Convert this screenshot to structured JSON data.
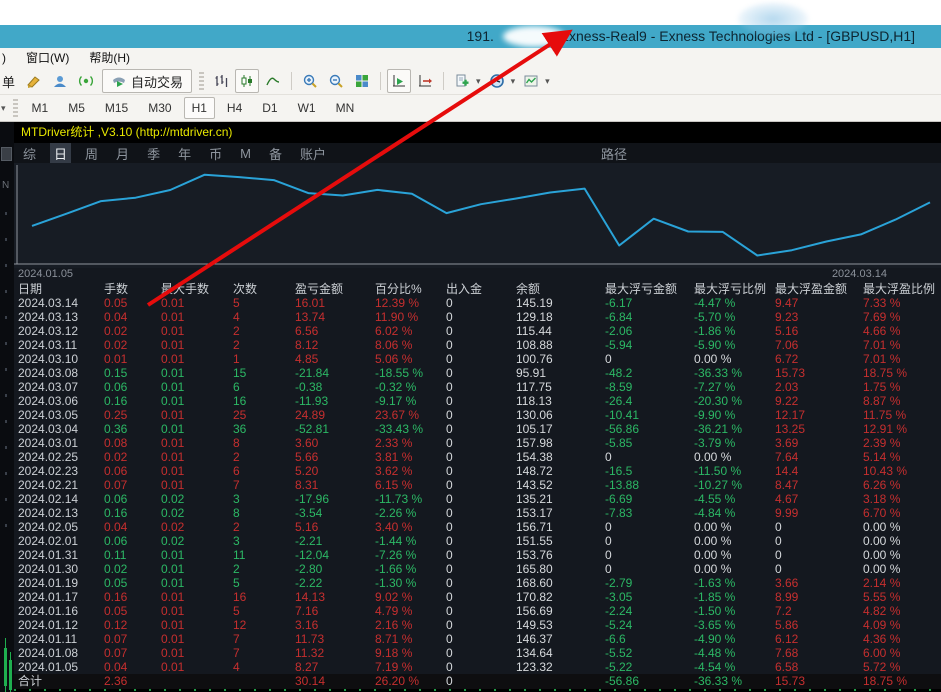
{
  "window": {
    "title_prefix": "191.",
    "title_rest": ". Exness-Real9 - Exness Technologies Ltd - [GBPUSD,H1]"
  },
  "menu": {
    "partial": ")",
    "items": [
      "窗口(W)",
      "帮助(H)"
    ]
  },
  "toolbar": {
    "partial_button": "单",
    "autotrade_label": "自动交易",
    "icons": [
      "crayon-icon",
      "community-icon",
      "signal-icon",
      "bar-chart-icon",
      "candlestick-icon",
      "line-chart-icon",
      "zoom-in-icon",
      "zoom-out-icon",
      "tile-windows-icon",
      "auto-scroll-icon",
      "chart-shift-icon",
      "new-template-icon",
      "period-icon",
      "indicators-icon"
    ],
    "timeframes": [
      "M1",
      "M5",
      "M15",
      "M30",
      "H1",
      "H4",
      "D1",
      "W1",
      "MN"
    ],
    "active_timeframe": "H1",
    "dropdown_caret": "▾"
  },
  "indicator": {
    "title": "MTDriver统计 ,V3.10 (http://mtdriver.cn)",
    "tabs": [
      "综",
      "日",
      "周",
      "月",
      "季",
      "年",
      "币",
      "M",
      "备",
      "账户"
    ],
    "active_tab": "日",
    "path_tab": "路径"
  },
  "chart_data": {
    "type": "line",
    "title": "",
    "x_dates": [
      "2024.01.05",
      "2024.01.08",
      "2024.01.11",
      "2024.01.12",
      "2024.01.16",
      "2024.01.17",
      "2024.01.19",
      "2024.01.30",
      "2024.01.31",
      "2024.02.01",
      "2024.02.05",
      "2024.02.13",
      "2024.02.14",
      "2024.02.21",
      "2024.02.23",
      "2024.02.25",
      "2024.03.01",
      "2024.03.04",
      "2024.03.05",
      "2024.03.06",
      "2024.03.07",
      "2024.03.08",
      "2024.03.10",
      "2024.03.11",
      "2024.03.12",
      "2024.03.13",
      "2024.03.14"
    ],
    "series": [
      {
        "name": "余额",
        "values": [
          123.32,
          134.64,
          146.37,
          149.53,
          156.69,
          170.82,
          168.6,
          165.8,
          153.76,
          151.55,
          156.71,
          153.17,
          135.21,
          143.52,
          148.72,
          154.38,
          157.98,
          105.17,
          130.06,
          118.13,
          117.75,
          95.91,
          100.76,
          108.88,
          115.44,
          129.18,
          145.19
        ]
      }
    ],
    "ylim": [
      88,
      178
    ],
    "xlabel_left": "2024.01.05",
    "xlabel_right": "2024.03.14",
    "line_color": "#2aa3d8",
    "grid": false,
    "legend": false
  },
  "table": {
    "headers": [
      "日期",
      "手数",
      "最大手数",
      "次数",
      "盈亏金额",
      "百分比%",
      "出入金",
      "余额",
      "最大浮亏金额",
      "最大浮亏比例",
      "最大浮盈金额",
      "最大浮盈比例"
    ],
    "rows": [
      {
        "date": "2024.03.14",
        "values": [
          "0.05",
          "0.01",
          "5",
          "16.01",
          "12.39 %",
          "0",
          "145.19",
          "-6.17",
          "-4.47 %",
          "9.47",
          "7.33 %"
        ],
        "colors": "rrrrrwwggrr"
      },
      {
        "date": "2024.03.13",
        "values": [
          "0.04",
          "0.01",
          "4",
          "13.74",
          "11.90 %",
          "0",
          "129.18",
          "-6.84",
          "-5.70 %",
          "9.23",
          "7.69 %"
        ],
        "colors": "rrrrrwwggrr"
      },
      {
        "date": "2024.03.12",
        "values": [
          "0.02",
          "0.01",
          "2",
          "6.56",
          "6.02 %",
          "0",
          "115.44",
          "-2.06",
          "-1.86 %",
          "5.16",
          "4.66 %"
        ],
        "colors": "rrrrrwwggrr"
      },
      {
        "date": "2024.03.11",
        "values": [
          "0.02",
          "0.01",
          "2",
          "8.12",
          "8.06 %",
          "0",
          "108.88",
          "-5.94",
          "-5.90 %",
          "7.06",
          "7.01 %"
        ],
        "colors": "rrrrrwwggrr"
      },
      {
        "date": "2024.03.10",
        "values": [
          "0.01",
          "0.01",
          "1",
          "4.85",
          "5.06 %",
          "0",
          "100.76",
          "0",
          "0.00 %",
          "6.72",
          "7.01 %"
        ],
        "colors": "rrrrrwwwwrr"
      },
      {
        "date": "2024.03.08",
        "values": [
          "0.15",
          "0.01",
          "15",
          "-21.84",
          "-18.55 %",
          "0",
          "95.91",
          "-48.2",
          "-36.33 %",
          "15.73",
          "18.75 %"
        ],
        "colors": "gggggwwggrr"
      },
      {
        "date": "2024.03.07",
        "values": [
          "0.06",
          "0.01",
          "6",
          "-0.38",
          "-0.32 %",
          "0",
          "117.75",
          "-8.59",
          "-7.27 %",
          "2.03",
          "1.75 %"
        ],
        "colors": "gggggwwggrr"
      },
      {
        "date": "2024.03.06",
        "values": [
          "0.16",
          "0.01",
          "16",
          "-11.93",
          "-9.17 %",
          "0",
          "118.13",
          "-26.4",
          "-20.30 %",
          "9.22",
          "8.87 %"
        ],
        "colors": "gggggwwggrr"
      },
      {
        "date": "2024.03.05",
        "values": [
          "0.25",
          "0.01",
          "25",
          "24.89",
          "23.67 %",
          "0",
          "130.06",
          "-10.41",
          "-9.90 %",
          "12.17",
          "11.75 %"
        ],
        "colors": "rrrrrwwggrr"
      },
      {
        "date": "2024.03.04",
        "values": [
          "0.36",
          "0.01",
          "36",
          "-52.81",
          "-33.43 %",
          "0",
          "105.17",
          "-56.86",
          "-36.21 %",
          "13.25",
          "12.91 %"
        ],
        "colors": "gggggwwggrr"
      },
      {
        "date": "2024.03.01",
        "values": [
          "0.08",
          "0.01",
          "8",
          "3.60",
          "2.33 %",
          "0",
          "157.98",
          "-5.85",
          "-3.79 %",
          "3.69",
          "2.39 %"
        ],
        "colors": "rrrrrwwggrr"
      },
      {
        "date": "2024.02.25",
        "values": [
          "0.02",
          "0.01",
          "2",
          "5.66",
          "3.81 %",
          "0",
          "154.38",
          "0",
          "0.00 %",
          "7.64",
          "5.14 %"
        ],
        "colors": "rrrrrwwwwrr"
      },
      {
        "date": "2024.02.23",
        "values": [
          "0.06",
          "0.01",
          "6",
          "5.20",
          "3.62 %",
          "0",
          "148.72",
          "-16.5",
          "-11.50 %",
          "14.4",
          "10.43 %"
        ],
        "colors": "rrrrrwwggrr"
      },
      {
        "date": "2024.02.21",
        "values": [
          "0.07",
          "0.01",
          "7",
          "8.31",
          "6.15 %",
          "0",
          "143.52",
          "-13.88",
          "-10.27 %",
          "8.47",
          "6.26 %"
        ],
        "colors": "rrrrrwwggrr"
      },
      {
        "date": "2024.02.14",
        "values": [
          "0.06",
          "0.02",
          "3",
          "-17.96",
          "-11.73 %",
          "0",
          "135.21",
          "-6.69",
          "-4.55 %",
          "4.67",
          "3.18 %"
        ],
        "colors": "gggggwwggrr"
      },
      {
        "date": "2024.02.13",
        "values": [
          "0.16",
          "0.02",
          "8",
          "-3.54",
          "-2.26 %",
          "0",
          "153.17",
          "-7.83",
          "-4.84 %",
          "9.99",
          "6.70 %"
        ],
        "colors": "gggggwwggrr"
      },
      {
        "date": "2024.02.05",
        "values": [
          "0.04",
          "0.02",
          "2",
          "5.16",
          "3.40 %",
          "0",
          "156.71",
          "0",
          "0.00 %",
          "0",
          "0.00 %"
        ],
        "colors": "rrrrrwwwwww"
      },
      {
        "date": "2024.02.01",
        "values": [
          "0.06",
          "0.02",
          "3",
          "-2.21",
          "-1.44 %",
          "0",
          "151.55",
          "0",
          "0.00 %",
          "0",
          "0.00 %"
        ],
        "colors": "gggggwwwwww"
      },
      {
        "date": "2024.01.31",
        "values": [
          "0.11",
          "0.01",
          "11",
          "-12.04",
          "-7.26 %",
          "0",
          "153.76",
          "0",
          "0.00 %",
          "0",
          "0.00 %"
        ],
        "colors": "gggggwwwwww"
      },
      {
        "date": "2024.01.30",
        "values": [
          "0.02",
          "0.01",
          "2",
          "-2.80",
          "-1.66 %",
          "0",
          "165.80",
          "0",
          "0.00 %",
          "0",
          "0.00 %"
        ],
        "colors": "gggggwwwwww"
      },
      {
        "date": "2024.01.19",
        "values": [
          "0.05",
          "0.01",
          "5",
          "-2.22",
          "-1.30 %",
          "0",
          "168.60",
          "-2.79",
          "-1.63 %",
          "3.66",
          "2.14 %"
        ],
        "colors": "gggggwwggrr"
      },
      {
        "date": "2024.01.17",
        "values": [
          "0.16",
          "0.01",
          "16",
          "14.13",
          "9.02 %",
          "0",
          "170.82",
          "-3.05",
          "-1.85 %",
          "8.99",
          "5.55 %"
        ],
        "colors": "rrrrrwwggrr"
      },
      {
        "date": "2024.01.16",
        "values": [
          "0.05",
          "0.01",
          "5",
          "7.16",
          "4.79 %",
          "0",
          "156.69",
          "-2.24",
          "-1.50 %",
          "7.2",
          "4.82 %"
        ],
        "colors": "rrrrrwwggrr"
      },
      {
        "date": "2024.01.12",
        "values": [
          "0.12",
          "0.01",
          "12",
          "3.16",
          "2.16 %",
          "0",
          "149.53",
          "-5.24",
          "-3.65 %",
          "5.86",
          "4.09 %"
        ],
        "colors": "rrrrrwwggrr"
      },
      {
        "date": "2024.01.11",
        "values": [
          "0.07",
          "0.01",
          "7",
          "11.73",
          "8.71 %",
          "0",
          "146.37",
          "-6.6",
          "-4.90 %",
          "6.12",
          "4.36 %"
        ],
        "colors": "rrrrrwwggrr"
      },
      {
        "date": "2024.01.08",
        "values": [
          "0.07",
          "0.01",
          "7",
          "11.32",
          "9.18 %",
          "0",
          "134.64",
          "-5.52",
          "-4.48 %",
          "7.68",
          "6.00 %"
        ],
        "colors": "rrrrrwwggrr"
      },
      {
        "date": "2024.01.05",
        "values": [
          "0.04",
          "0.01",
          "4",
          "8.27",
          "7.19 %",
          "0",
          "123.32",
          "-5.22",
          "-4.54 %",
          "6.58",
          "5.72 %"
        ],
        "colors": "rrrrrwwggrr"
      }
    ],
    "total_row": {
      "date": "合计",
      "values": [
        "2.36",
        "",
        "",
        "30.14",
        "26.20 %",
        "0",
        "",
        "-56.86",
        "-36.33 %",
        "15.73",
        "18.75 %"
      ],
      "colors": "rwwrrwwggrr"
    }
  },
  "colors": {
    "titlebar": "#41a8c8",
    "panel_bg": "#14181f",
    "chart_bg": "#171c24",
    "line": "#2aa3d8",
    "gain_red": "#c62f2f",
    "loss_green": "#2cb865",
    "indicator_title_yellow": "#e8e800",
    "annotation_arrow": "#e60c0c"
  }
}
